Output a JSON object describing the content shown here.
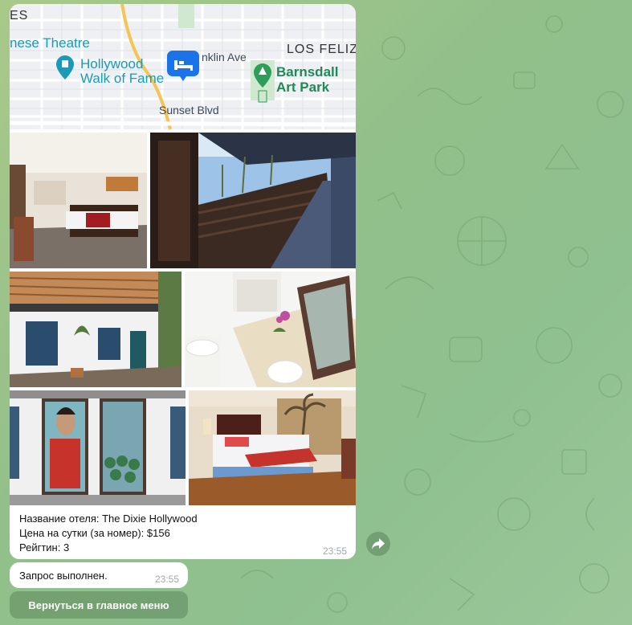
{
  "map": {
    "labels": {
      "es": "ES",
      "theatre": "nese Theatre",
      "walk_line1": "Hollywood",
      "walk_line2": "Walk of Fame",
      "avenue": "nklin Ave",
      "los_feliz": "LOS FELIZ",
      "park_line1": "Barnsdall",
      "park_line2": "Art Park",
      "sunset": "Sunset Blvd"
    }
  },
  "photos": [
    {
      "name": "hotel-room-photo"
    },
    {
      "name": "balcony-walkway-photo"
    },
    {
      "name": "exterior-building-photo"
    },
    {
      "name": "bathroom-photo"
    },
    {
      "name": "mural-doors-photo"
    },
    {
      "name": "bedroom-palm-mural-photo"
    }
  ],
  "hotel_message": {
    "name_line": "Название отеля: The Dixie Hollywood",
    "price_line": "Цена на сутки (за номер): $156",
    "rating_line": "Рейгтин: 3",
    "time": "23:55"
  },
  "status_message": {
    "text": "Запрос выполнен.",
    "time": "23:55"
  },
  "keyboard": {
    "back_button": "Вернуться в главное меню"
  },
  "colors": {
    "accent_green": "#1f8a55",
    "map_pin_blue": "#1a73e8",
    "button_bg": "#6a9a63"
  }
}
